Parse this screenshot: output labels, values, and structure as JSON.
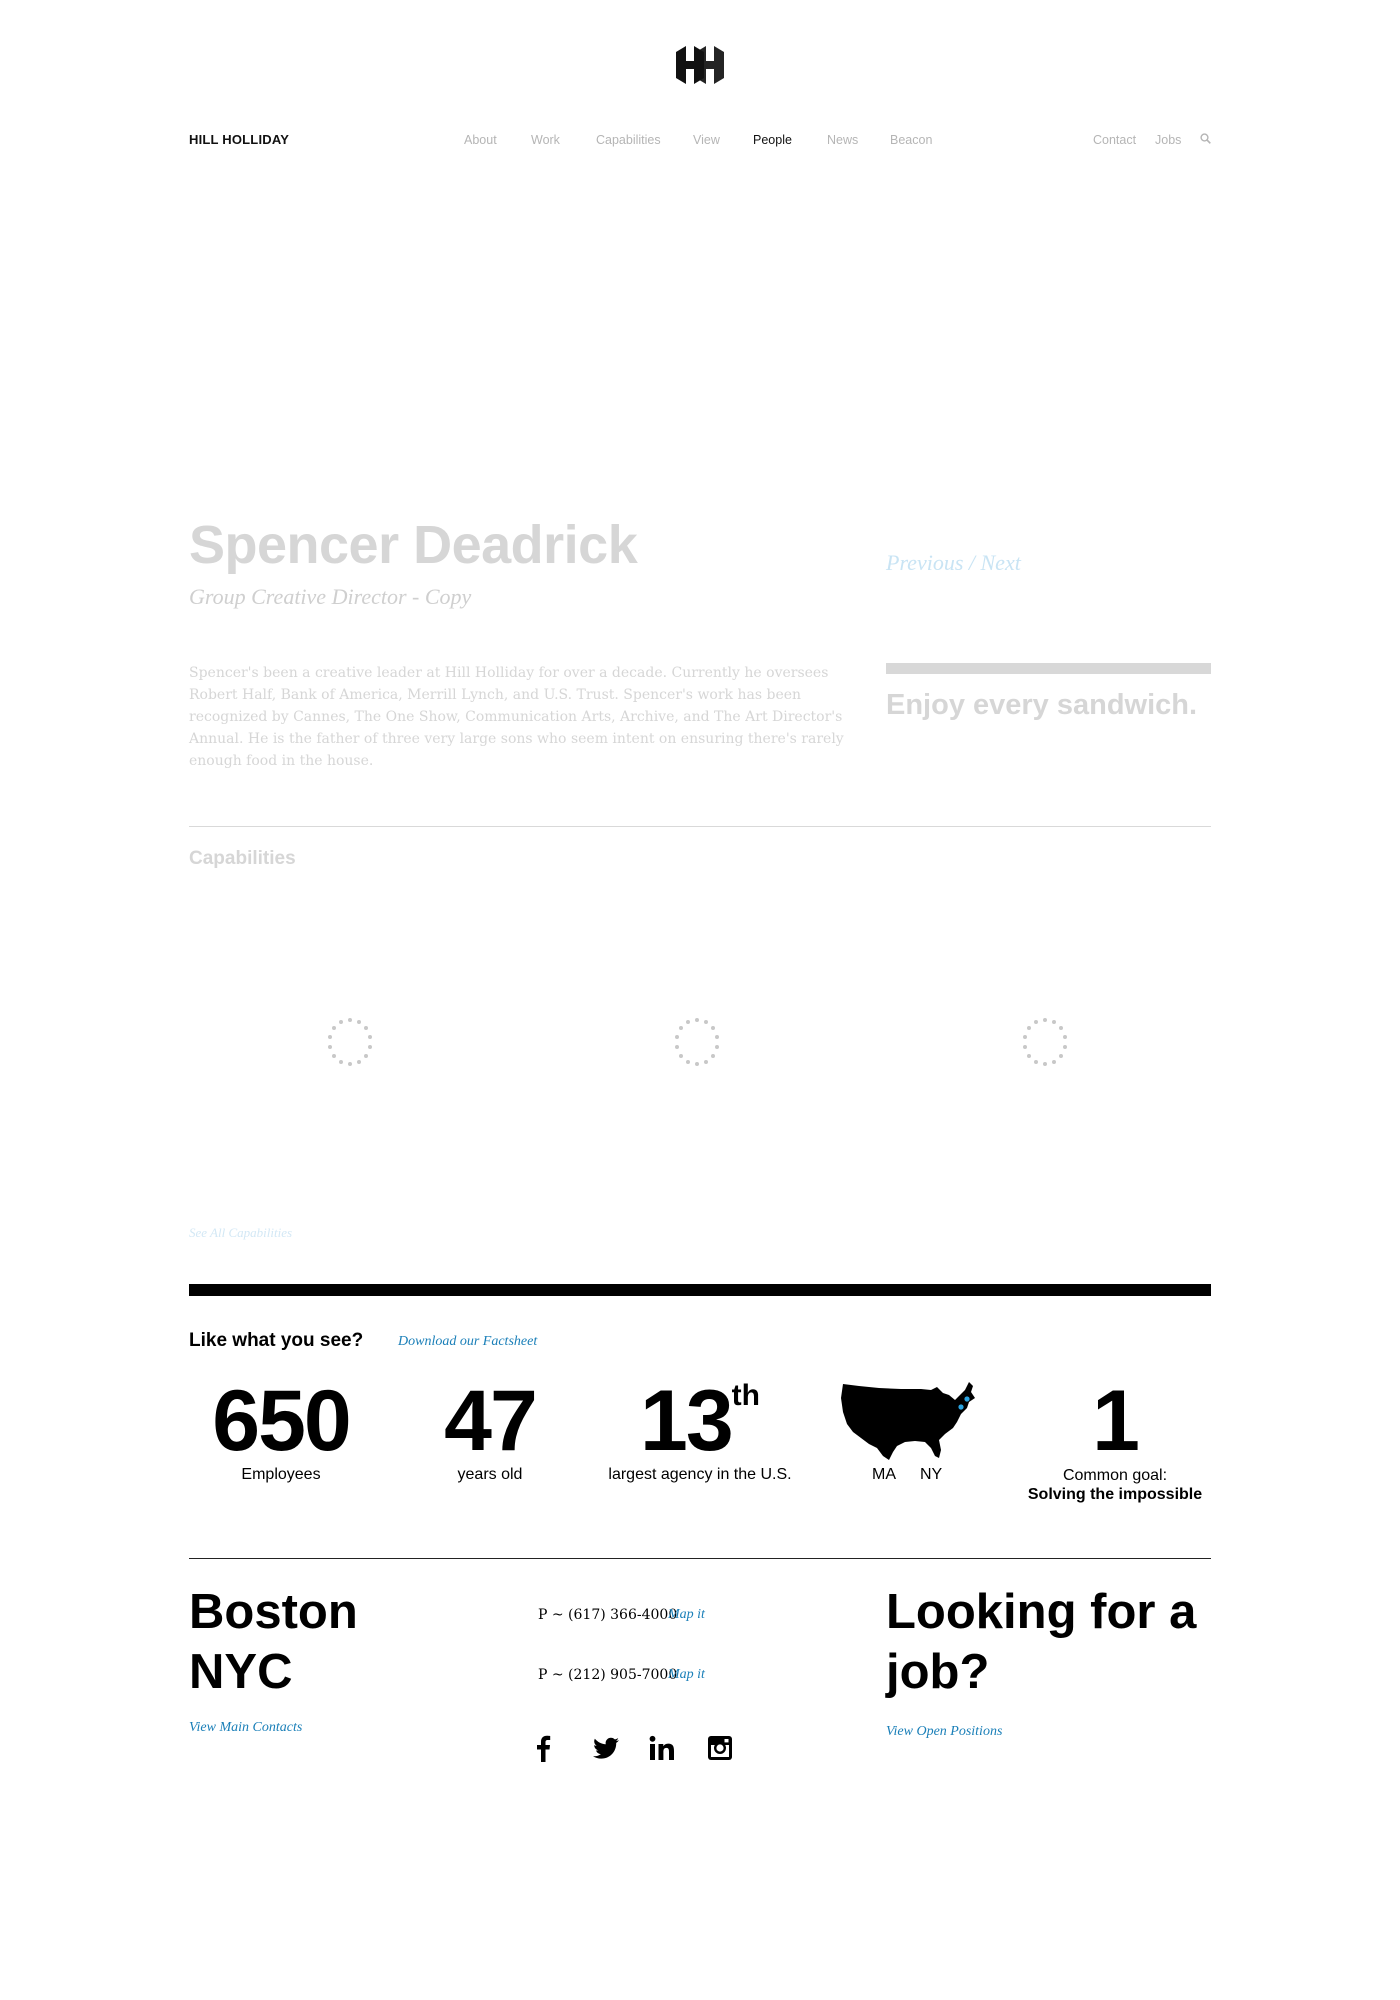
{
  "header": {
    "brand": "HILL HOLLIDAY",
    "nav": [
      "About",
      "Work",
      "Capabilities",
      "View",
      "People",
      "News",
      "Beacon"
    ],
    "active_nav": "People",
    "utility": [
      "Contact",
      "Jobs"
    ],
    "icons": {
      "logo": "hh-logo",
      "search": "search-icon"
    }
  },
  "profile": {
    "name": "Spencer Deadrick",
    "role": "Group Creative Director - Copy",
    "bio": "Spencer's been a creative leader at Hill Holliday for over a decade. Currently he oversees Robert Half, Bank of America, Merrill Lynch, and U.S. Trust. Spencer's work has been recognized by Cannes, The One Show, Communication Arts, Archive, and The Art Director's Annual. He is the father of three very large sons who seem intent on ensuring there's rarely enough food in the house.",
    "pager": "Previous / Next",
    "quote": "Enjoy every sandwich.",
    "capabilities_heading": "Capabilities",
    "see_all": "See All Capabilities"
  },
  "stats": {
    "heading": "Like what you see?",
    "factsheet_link": "Download our Factsheet",
    "employees": {
      "value": "650",
      "label": "Employees"
    },
    "years": {
      "value": "47",
      "label": "years old"
    },
    "rank": {
      "value": "13",
      "suffix": "th",
      "label": "largest agency in the U.S."
    },
    "map": {
      "label_ma": "MA",
      "label_ny": "NY",
      "icon": "us-map-icon"
    },
    "goal": {
      "value": "1",
      "label": "Common goal:",
      "label_bold": "Solving the impossible"
    }
  },
  "footer": {
    "city_boston": "Boston",
    "city_nyc": "NYC",
    "phone_boston": "P ~ (617) 366-4000",
    "phone_nyc": "P ~ (212) 905-7000",
    "map_it": "Map it",
    "view_contacts": "View Main Contacts",
    "job_heading": "Looking for a job?",
    "view_positions": "View Open Positions",
    "social": [
      "facebook-icon",
      "twitter-icon",
      "linkedin-icon",
      "instagram-icon"
    ]
  },
  "colors": {
    "link": "#1a7fb8",
    "faded": "#d6d6d6",
    "text": "#111111"
  }
}
